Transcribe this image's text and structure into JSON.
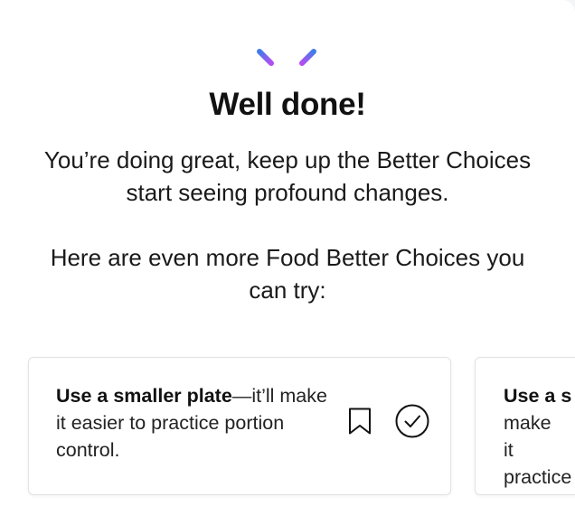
{
  "header": {
    "title": "Well done!",
    "message": "You’re doing great, keep up the Better Choices start seeing profound changes.",
    "prompt": "Here are even more Food Better Choices you can try:"
  },
  "icons": {
    "header": "sparkle-icon",
    "save": "bookmark-icon",
    "complete": "check-circle-icon"
  },
  "colors": {
    "sparkle_start": "#3f7ce8",
    "sparkle_end": "#b54df2"
  },
  "cards": [
    {
      "bold": "Use a smaller plate",
      "rest": "—it’ll make it easier to practice portion control."
    },
    {
      "bold": "Use a s",
      "rest": "make it practice"
    }
  ]
}
